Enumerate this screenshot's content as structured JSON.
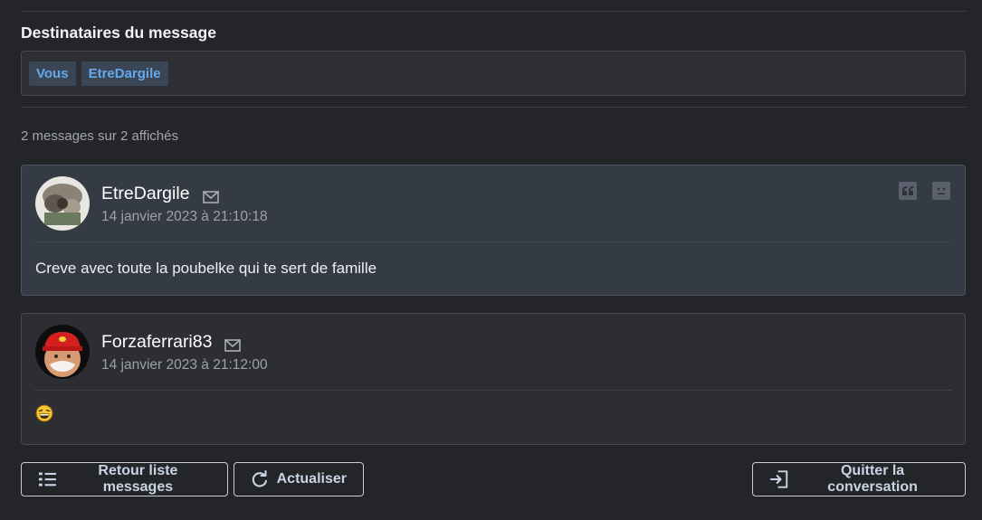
{
  "recipients": {
    "title": "Destinataires du message",
    "tags": [
      "Vous",
      "EtreDargile"
    ]
  },
  "message_count": "2 messages sur 2 affichés",
  "messages": [
    {
      "author": "EtreDargile",
      "date": "14 janvier 2023 à 21:10:18",
      "body": "Creve avec toute la poubelke qui te sert de famille",
      "icons": [
        "mail-icon",
        "quote-icon",
        "report-icon"
      ]
    },
    {
      "author": "Forzaferrari83",
      "date": "14 janvier 2023 à 21:12:00",
      "body": "",
      "icons": [
        "mail-icon",
        "laughing-emoji-icon"
      ]
    }
  ],
  "buttons": {
    "back": "Retour liste messages",
    "refresh": "Actualiser",
    "quit": "Quitter la conversation"
  },
  "colors": {
    "background": "#232529",
    "tag_text": "#66a9ea",
    "highlight_card": "#353b45",
    "button_text": "#c8d4e4"
  }
}
